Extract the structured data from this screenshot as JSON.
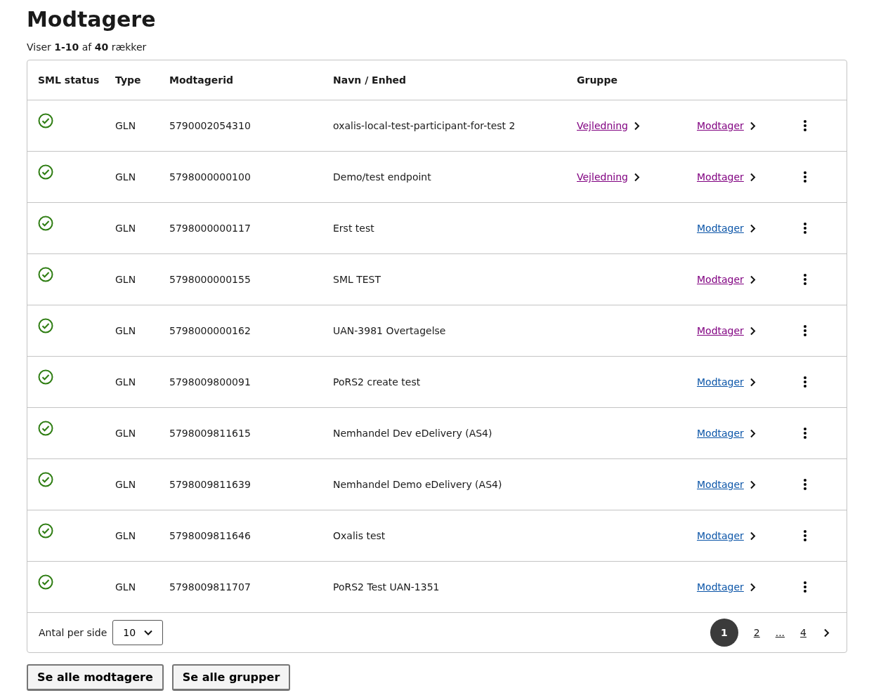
{
  "title": "Modtagere",
  "summary": "Viser **1-10** af **40** rækker",
  "table": {
    "columns": [
      "SML status",
      "Type",
      "Modtagerid",
      "Navn / Enhed",
      "Gruppe"
    ],
    "rows": [
      {
        "type": "GLN",
        "id": "5790002054310",
        "name": "oxalis-local-test-participant-for-test 2",
        "group_link": {
          "label": "Vejledning",
          "visited": true
        },
        "recipient_link": {
          "label": "Modtager",
          "visited": true
        }
      },
      {
        "type": "GLN",
        "id": "5798000000100",
        "name": "Demo/test endpoint",
        "group_link": {
          "label": "Vejledning",
          "visited": true
        },
        "recipient_link": {
          "label": "Modtager",
          "visited": true
        }
      },
      {
        "type": "GLN",
        "id": "5798000000117",
        "name": "Erst test",
        "recipient_link": {
          "label": "Modtager",
          "visited": false
        }
      },
      {
        "type": "GLN",
        "id": "5798000000155",
        "name": "SML TEST",
        "recipient_link": {
          "label": "Modtager",
          "visited": true
        }
      },
      {
        "type": "GLN",
        "id": "5798000000162",
        "name": "UAN-3981 Overtagelse",
        "recipient_link": {
          "label": "Modtager",
          "visited": true
        }
      },
      {
        "type": "GLN",
        "id": "5798009800091",
        "name": "PoRS2 create test",
        "recipient_link": {
          "label": "Modtager",
          "visited": false
        }
      },
      {
        "type": "GLN",
        "id": "5798009811615",
        "name": "Nemhandel Dev eDelivery (AS4)",
        "recipient_link": {
          "label": "Modtager",
          "visited": false
        }
      },
      {
        "type": "GLN",
        "id": "5798009811639",
        "name": "Nemhandel Demo eDelivery (AS4)",
        "recipient_link": {
          "label": "Modtager",
          "visited": false
        }
      },
      {
        "type": "GLN",
        "id": "5798009811646",
        "name": "Oxalis test",
        "recipient_link": {
          "label": "Modtager",
          "visited": false
        }
      },
      {
        "type": "GLN",
        "id": "5798009811707",
        "name": "PoRS2 Test UAN-1351",
        "recipient_link": {
          "label": "Modtager",
          "visited": false
        }
      }
    ]
  },
  "footer": {
    "per_page_label": "Antal per side",
    "per_page_value": "10",
    "pages": [
      {
        "label": "1",
        "selected": true
      },
      {
        "label": "2",
        "selected": false
      },
      {
        "label": "...",
        "selected": false
      },
      {
        "label": "4",
        "selected": false
      }
    ]
  },
  "buttons": [
    "Se alle modtagere",
    "Se alle grupper"
  ]
}
